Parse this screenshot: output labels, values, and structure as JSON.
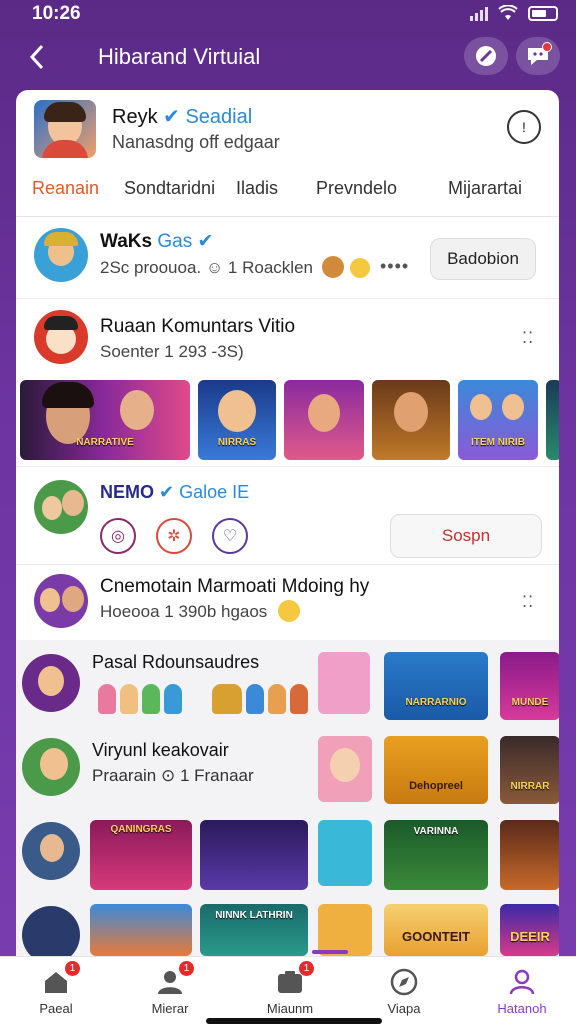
{
  "status": {
    "time": "10:26"
  },
  "header": {
    "title": "Hibarand Virtuial"
  },
  "profile": {
    "name": "Reyk",
    "badge": "Seadial",
    "subtitle": "Nanasdng off edgaar"
  },
  "tabs": [
    {
      "label": "Reanain",
      "active": true
    },
    {
      "label": "Sondtaridni",
      "active": false
    },
    {
      "label": "Iladis",
      "active": false
    },
    {
      "label": "Prevndelo",
      "active": false
    },
    {
      "label": "Mijarartai",
      "active": false
    }
  ],
  "rows": {
    "waks": {
      "name": "WaKs",
      "badge": "Gas",
      "sub": "2Sc proouoa. ☺ 1 Roacklen",
      "more": "••••",
      "button": "Badobion"
    },
    "community": {
      "title": "Ruaan Komuntars Vitio",
      "sub": "Soenter 1 293 -3S)",
      "more": "⁚⁚"
    },
    "nemo": {
      "name": "NEMO",
      "badge": "Galoe IE",
      "button": "Sospn"
    },
    "crema": {
      "title": "Cnemotain Marmoati Mdoing hy",
      "sub": "Hoeooa 1 390b hgaos",
      "more": "⁚⁚"
    }
  },
  "thumbs": [
    {
      "caption": "NARRATIVE"
    },
    {
      "caption": "NIRRAS"
    },
    {
      "caption": ""
    },
    {
      "caption": ""
    },
    {
      "caption": "ITEM NIRIB"
    },
    {
      "caption": ""
    }
  ],
  "grid": {
    "row1": {
      "title": "Pasal Rdounsaudres",
      "tiles": [
        "",
        "NARRARNIO",
        "MUNDE"
      ]
    },
    "row2": {
      "title": "Viryunl keakovair",
      "sub": "Praarain ⊙ 1 Franaar",
      "tiles": [
        "",
        "Dehopreel",
        "NIRRAR"
      ]
    },
    "row3": {
      "tiles": [
        "QANINGRAS",
        "",
        "",
        "VARINNA",
        ""
      ]
    },
    "row4": {
      "tiles": [
        "",
        "NINNK LATHRIN",
        "",
        "GOONTEIT",
        "DEEIR"
      ]
    }
  },
  "tabbar": [
    {
      "label": "Paeal",
      "icon": "home-icon",
      "badge": "1",
      "active": false
    },
    {
      "label": "Mierar",
      "icon": "people-icon",
      "badge": "1",
      "active": false
    },
    {
      "label": "Miaunm",
      "icon": "inbox-icon",
      "badge": "1",
      "active": false
    },
    {
      "label": "Viapa",
      "icon": "compass-icon",
      "badge": "",
      "active": false
    },
    {
      "label": "Hatanoh",
      "icon": "profile-icon",
      "badge": "",
      "active": true
    }
  ],
  "colors": {
    "accent": "#8a3ac0",
    "header_bg": "#5b2a86",
    "active_tab": "#e05a2b",
    "verified": "#2b8ad8"
  }
}
